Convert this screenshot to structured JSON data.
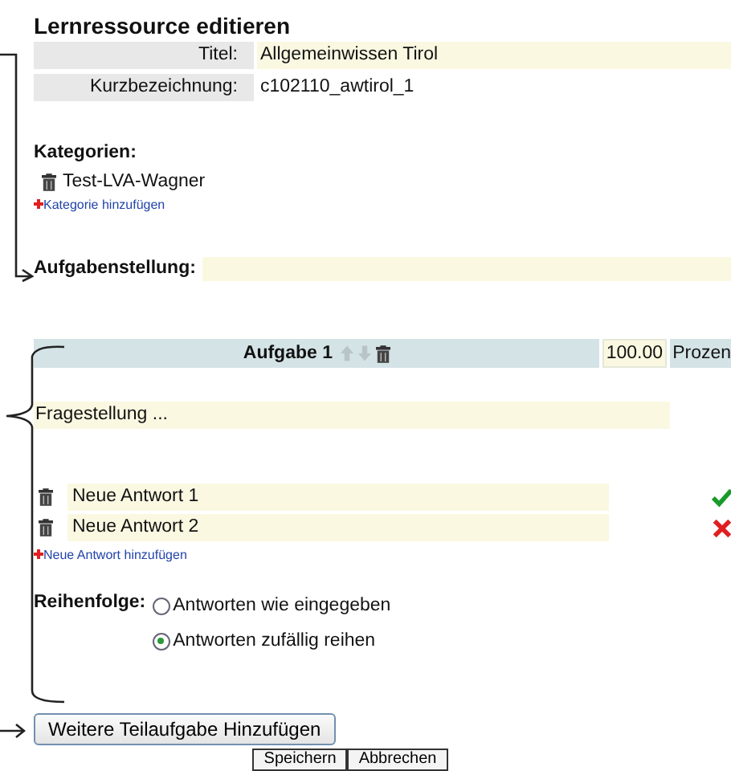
{
  "title": "Lernressource editieren",
  "fields": [
    {
      "label": "Titel:",
      "value": "Allgemeinwissen Tirol",
      "editable": true
    },
    {
      "label": "Kurzbezeichnung:",
      "value": "c102110_awtirol_1",
      "editable": false
    }
  ],
  "categories": {
    "heading": "Kategorien:",
    "items": [
      "Test-LVA-Wagner"
    ],
    "add_link": "Kategorie hinzufügen"
  },
  "task_statement": {
    "label": "Aufgabenstellung:"
  },
  "task": {
    "title": "Aufgabe 1",
    "score": "100.00",
    "score_unit": "Prozen",
    "question": "Fragestellung ...",
    "answers": [
      {
        "text": "Neue Antwort 1",
        "correct": true
      },
      {
        "text": "Neue Antwort 2",
        "correct": false
      }
    ],
    "add_answer_link": "Neue Antwort hinzufügen",
    "order_label": "Reihenfolge:",
    "order_options": [
      {
        "label": "Antworten wie eingegeben",
        "selected": false
      },
      {
        "label": "Antworten zufällig reihen",
        "selected": true
      }
    ]
  },
  "add_subtask_button": "Weitere Teilaufgabe Hinzufügen",
  "buttons": [
    "Speichern",
    "Abbrechen"
  ]
}
